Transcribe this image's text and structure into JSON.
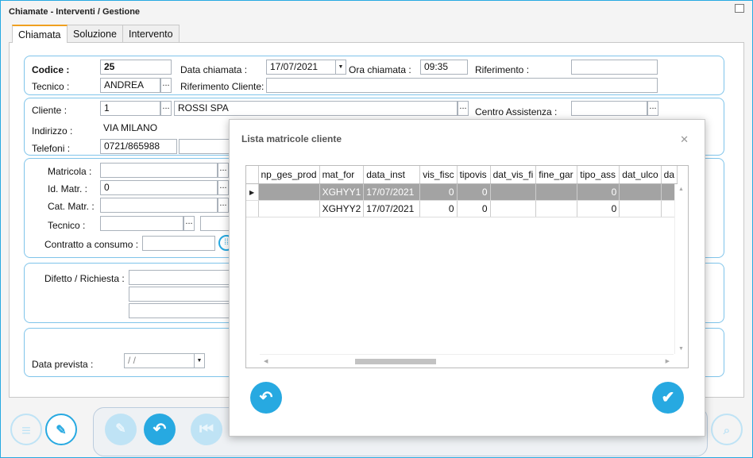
{
  "window": {
    "title": "Chiamate - Interventi / Gestione"
  },
  "tabs": [
    "Chiamata",
    "Soluzione",
    "Intervento"
  ],
  "form": {
    "codice_label": "Codice :",
    "codice_value": "25",
    "data_chiamata_label": "Data chiamata :",
    "data_chiamata_value": "17/07/2021",
    "ora_chiamata_label": "Ora chiamata :",
    "ora_chiamata_value": "09:35",
    "riferimento_label": "Riferimento :",
    "riferimento_value": "",
    "tecnico_label": "Tecnico :",
    "tecnico_value": "ANDREA",
    "rif_cliente_label": "Riferimento Cliente:",
    "rif_cliente_value": "",
    "cliente_label": "Cliente :",
    "cliente_code": "1",
    "cliente_name": "ROSSI SPA",
    "centro_label": "Centro Assistenza :",
    "centro_value": "",
    "indirizzo_label": "Indirizzo :",
    "indirizzo_value": "VIA MILANO",
    "telefoni_label": "Telefoni :",
    "telefoni_value": "0721/865988",
    "matricola_label": "Matricola :",
    "matricola_value": "",
    "id_matr_label": "Id. Matr. :",
    "id_matr_value": "0",
    "cat_matr_label": "Cat. Matr. :",
    "cat_matr_value": "",
    "tecnico2_label": "Tecnico :",
    "contratto_label": "Contratto a consumo :",
    "difetto_label": "Difetto / Richiesta :",
    "data_prevista_label": "Data prevista :",
    "data_prevista_value": " /  /"
  },
  "dialog": {
    "title": "Lista matricole cliente",
    "close_icon": "close-icon",
    "columns": [
      "np_ges_prod",
      "mat_for",
      "data_inst",
      "vis_fisc",
      "tipovis",
      "dat_vis_fi",
      "fine_gar",
      "tipo_ass",
      "dat_ulco",
      "da"
    ],
    "rows": [
      [
        "",
        "XGHYY1",
        "17/07/2021",
        "0",
        "0",
        "",
        "",
        "0",
        "",
        ""
      ],
      [
        "",
        "XGHYY2",
        "17/07/2021",
        "0",
        "0",
        "",
        "",
        "0",
        "",
        ""
      ]
    ],
    "selected_row": 0,
    "undo_icon": "undo-icon",
    "confirm_icon": "check-icon"
  },
  "colors": {
    "accent": "#27a9e1",
    "selected_row": "#a3a3a3",
    "active_tab": "#f0a020"
  }
}
